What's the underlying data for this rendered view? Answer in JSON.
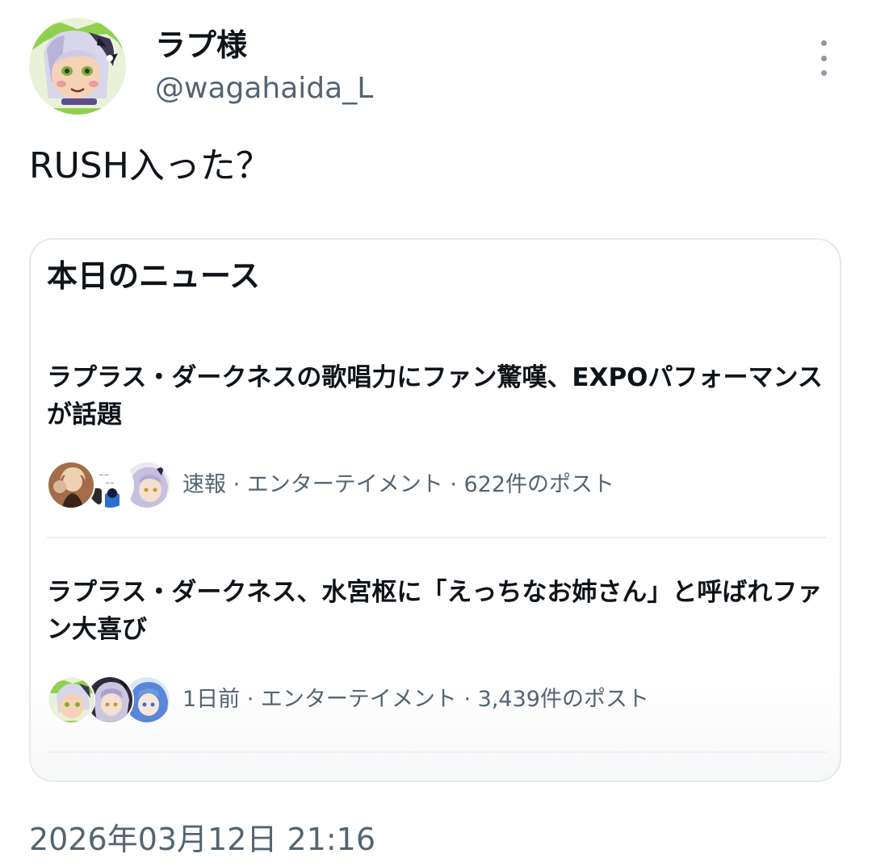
{
  "author": {
    "display_name": "ラプ様",
    "handle": "@wagahaida_L",
    "avatar_icon": "user-avatar-icon"
  },
  "tweet": {
    "text": "RUSH入った？",
    "timestamp": "2026年03月12日 21:16"
  },
  "news_card": {
    "title": "本日のニュース",
    "items": [
      {
        "headline": "ラプラス・ダークネスの歌唱力にファン驚嘆、EXPOパフォーマンスが話題",
        "meta": "速報 · エンターテイメント · 622件のポスト"
      },
      {
        "headline": "ラプラス・ダークネス、水宮枢に「えっちなお姉さん」と呼ばれファン大喜び",
        "meta": "1日前 · エンターテイメント · 3,439件のポスト"
      }
    ]
  },
  "colors": {
    "primary_text": "#0f1419",
    "secondary_text": "#536471",
    "border": "#e6e9eb"
  }
}
